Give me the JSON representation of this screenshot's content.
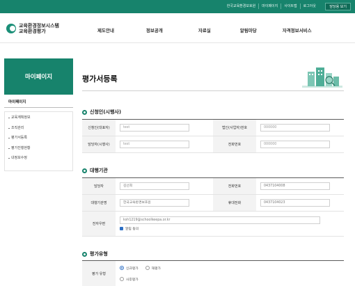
{
  "top_util": {
    "links": [
      "한국교육환경보호원",
      "마이페이지",
      "사이트맵",
      "로그아웃"
    ],
    "button": "담당용 보기"
  },
  "logo": {
    "line1": "교육환경정보시스템",
    "line2": "교육환경평가"
  },
  "gnb": [
    "제도안내",
    "정보공개",
    "자료실",
    "알림마당",
    "자격정보서비스"
  ],
  "sidebar": {
    "title": "마이페이지",
    "section": "마이페이지",
    "items": [
      "교육계획정보",
      "조직관리",
      "평가서등록",
      "평가진행현황",
      "내정보수정"
    ]
  },
  "main": {
    "page_title": "평가서등록",
    "applicant": {
      "title": "신청인(시행사)",
      "name_label": "신청인(대표자)",
      "name_value": "test",
      "bizno_label": "법인(사업자)번호",
      "bizno_value": "000000",
      "manager_label": "담당자(시행사)",
      "manager_value": "test",
      "phone_label": "전화번호",
      "phone_value": "000000"
    },
    "agency": {
      "title": "대행기관",
      "manager_label": "담당자",
      "manager_value": "김선희",
      "phone_label": "전화번호",
      "phone_value": "0437104008",
      "org_label": "대행기관명",
      "org_value": "한국교육환경보호원",
      "mobile_label": "휴대전화",
      "mobile_value": "0437104023",
      "email_label": "전자우편",
      "email_value": "ksh1219@schoolkeepa.or.kr",
      "consent_label": "알림 동의"
    },
    "eval_type": {
      "title": "평가유형",
      "label": "평가 유형",
      "options": [
        "신규평가",
        "재평가",
        "사후평가"
      ]
    }
  },
  "colors": {
    "primary": "#17836c",
    "checkbox": "#2d6fc4"
  }
}
